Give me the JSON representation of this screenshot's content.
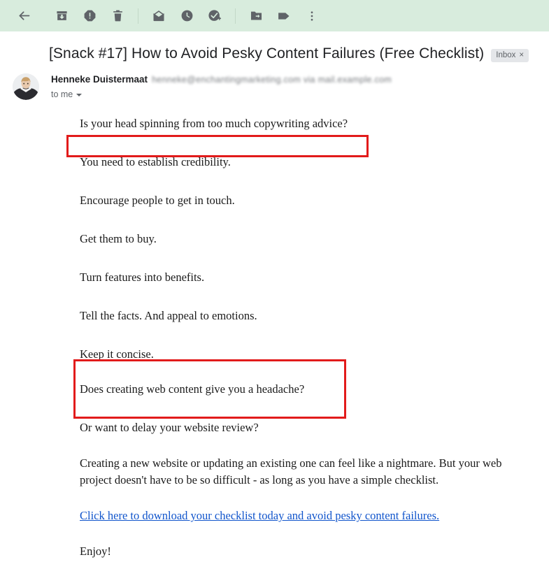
{
  "toolbar": {
    "items": [
      {
        "name": "back-button",
        "icon": "back-arrow-icon",
        "label": "Back to Inbox"
      },
      {
        "name": "archive-button",
        "icon": "archive-icon",
        "label": "Archive"
      },
      {
        "name": "report-spam-button",
        "icon": "report-spam-icon",
        "label": "Report spam"
      },
      {
        "name": "delete-button",
        "icon": "trash-icon",
        "label": "Delete"
      },
      {
        "name": "mark-unread-button",
        "icon": "envelope-icon",
        "label": "Mark as unread"
      },
      {
        "name": "snooze-button",
        "icon": "clock-icon",
        "label": "Snooze"
      },
      {
        "name": "add-to-tasks-button",
        "icon": "check-plus-icon",
        "label": "Add to Tasks"
      },
      {
        "name": "move-to-button",
        "icon": "folder-arrow-icon",
        "label": "Move to"
      },
      {
        "name": "labels-button",
        "icon": "tag-icon",
        "label": "Labels"
      },
      {
        "name": "more-button",
        "icon": "more-vertical-icon",
        "label": "More"
      }
    ]
  },
  "subject": {
    "text": "[Snack #17] How to Avoid Pesky Content Failures (Free Checklist)",
    "chip_label": "Inbox",
    "chip_close": "×"
  },
  "sender": {
    "name": "Henneke Duistermaat",
    "email": "henneke@enchantingmarketing.com via mail.example.com",
    "recipient": "to me"
  },
  "body": {
    "paragraphs": [
      {
        "text": "Is your head spinning from too much copywriting advice?",
        "highlighted": true
      },
      {
        "text": "You need to establish credibility.",
        "highlighted": false
      },
      {
        "text": "Encourage people to get in touch.",
        "highlighted": false
      },
      {
        "text": "Get them to buy.",
        "highlighted": false
      },
      {
        "text": "Turn features into benefits.",
        "highlighted": false
      },
      {
        "text": "Tell the facts. And appeal to emotions.",
        "highlighted": false
      },
      {
        "text": "Keep it concise.",
        "highlighted": false
      },
      {
        "text": "Does creating web content give you a headache?",
        "highlighted": true
      },
      {
        "text": "Or want to delay your website review?",
        "highlighted": true
      },
      {
        "text": "Creating a new website or updating an existing one can feel like a nightmare. But your web project doesn't have to be so difficult - as long as you have a simple checklist.",
        "highlighted": false
      }
    ],
    "link_text": "Click here to download your checklist today and avoid pesky content failures.",
    "closing": "Enjoy!"
  },
  "colors": {
    "toolbar_background": "#d8ecdd",
    "annotation_red": "#e21b1b",
    "link_blue": "#1155cc",
    "chip_background": "#e4e6e9",
    "icon_gray": "#5f6368"
  }
}
